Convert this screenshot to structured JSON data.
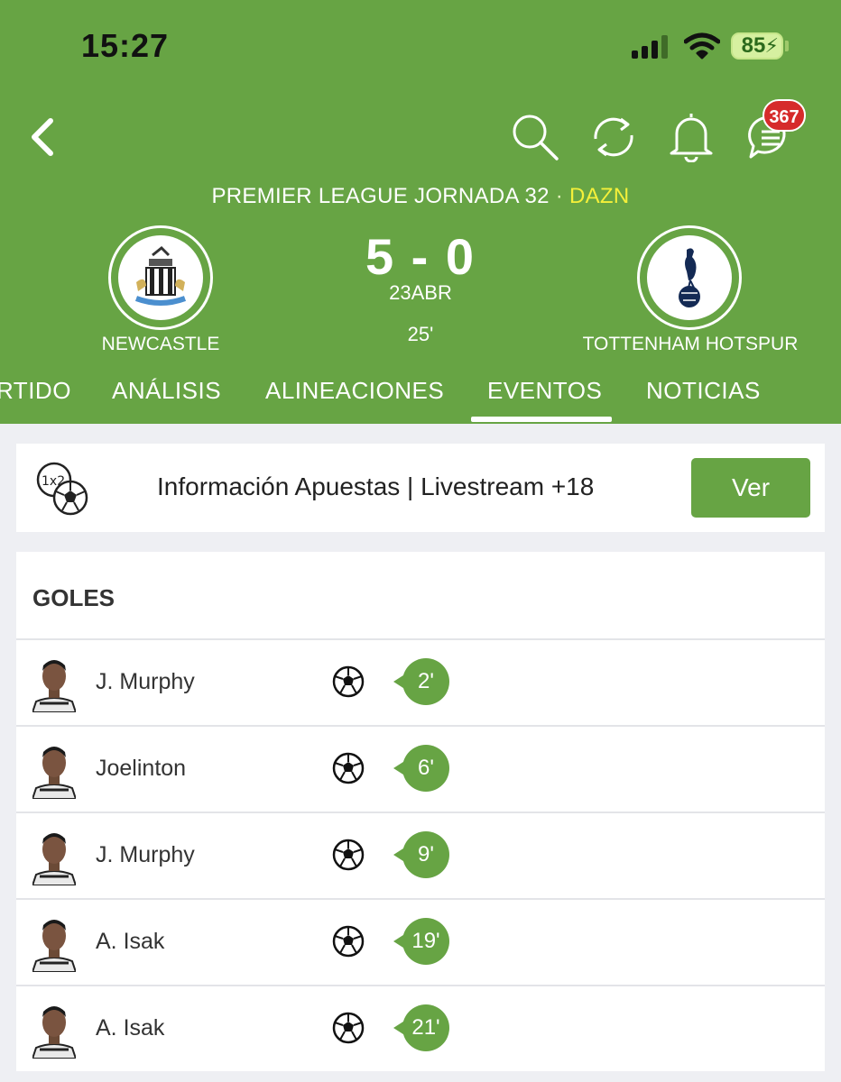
{
  "status_bar": {
    "time": "15:27",
    "battery": "85"
  },
  "header": {
    "badge_count": "367",
    "league": "PREMIER LEAGUE JORNADA 32",
    "separator": "·",
    "tv": "DAZN",
    "score": "5 - 0",
    "date": "23ABR",
    "minute": "25'",
    "home_team": "NEWCASTLE",
    "away_team": "TOTTENHAM HOTSPUR"
  },
  "tabs": [
    {
      "label": "RTIDO"
    },
    {
      "label": "ANÁLISIS"
    },
    {
      "label": "ALINEACIONES"
    },
    {
      "label": "EVENTOS",
      "active": true
    },
    {
      "label": "NOTICIAS"
    }
  ],
  "promo": {
    "text": "Información Apuestas | Livestream +18",
    "button": "Ver"
  },
  "goals": {
    "title": "GOLES",
    "rows": [
      {
        "player": "J. Murphy",
        "minute": "2'"
      },
      {
        "player": "Joelinton",
        "minute": "6'"
      },
      {
        "player": "J. Murphy",
        "minute": "9'"
      },
      {
        "player": "A. Isak",
        "minute": "19'"
      },
      {
        "player": "A. Isak",
        "minute": "21'"
      }
    ]
  },
  "colors": {
    "brand_green": "#67a444",
    "tv_yellow": "#f5f03a",
    "badge_red": "#d62b2b",
    "background": "#eeeff3"
  },
  "icons": [
    "back-icon",
    "search-icon",
    "refresh-icon",
    "bell-icon",
    "chat-icon",
    "betting-icon",
    "soccer-ball-icon",
    "newcastle-crest-icon",
    "tottenham-crest-icon",
    "signal-icon",
    "wifi-icon",
    "battery-icon"
  ]
}
